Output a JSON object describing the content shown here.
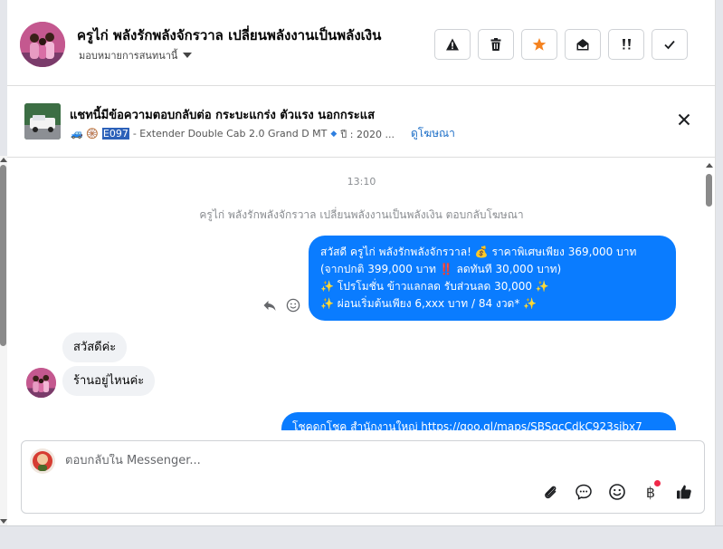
{
  "header": {
    "contact_name": "ครูไก่ พลังรักพลังจักรวาล เปลี่ยนพลังงานเป็นพลังเงิน",
    "assign_label": "มอบหมายการสนทนานี้",
    "actions": [
      {
        "icon": "warning-icon"
      },
      {
        "icon": "trash-icon"
      },
      {
        "icon": "star-icon",
        "color": "#f5821f"
      },
      {
        "icon": "envelope-open-icon"
      },
      {
        "icon": "follow-up-icon"
      },
      {
        "icon": "check-icon"
      }
    ]
  },
  "ad": {
    "title": "แชทนี้มีข้อความตอบกลับต่อ กระบะแกร่ง ตัวแรง นอกกระแส",
    "emoji": "🚙 🛞",
    "code": "E097",
    "model": "- Extender Double Cab 2.0 Grand D MT",
    "year": "ปี : 2020 ...",
    "view_ad": "ดูโฆษณา"
  },
  "conversation": {
    "time": "13:10",
    "system_line": "ครูไก่ พลังรักพลังจักรวาล เปลี่ยนพลังงานเป็นพลังเงิน ตอบกลับโฆษณา",
    "outgoing_lines": [
      "สวัสดี ครูไก่ พลังรักพลังจักรวาล! 💰 ราคาพิเศษเพียง 369,000 บาท",
      "(จากปกติ 399,000 บาท ‼️ ลดทันที 30,000 บาท)",
      "✨ โปรโมชั่น ข้าวแลกลด รับส่วนลด 30,000 ✨",
      "✨ ผ่อนเริ่มต้นเพียง 6,xxx บาท / 84 งวด* ✨"
    ],
    "incoming": [
      {
        "text": "สวัสดีค่ะ"
      },
      {
        "text": "ร้านอยู่ไหนค่ะ"
      }
    ],
    "outgoing_2": "โชคดกโชค สำนักงานใหญ่ https://goo.gl/maps/SBSqcCdkC923sjbx7"
  },
  "composer": {
    "placeholder": "ตอบกลับใน Messenger...",
    "currency_symbol": "฿",
    "accent": "#0a7cff"
  }
}
